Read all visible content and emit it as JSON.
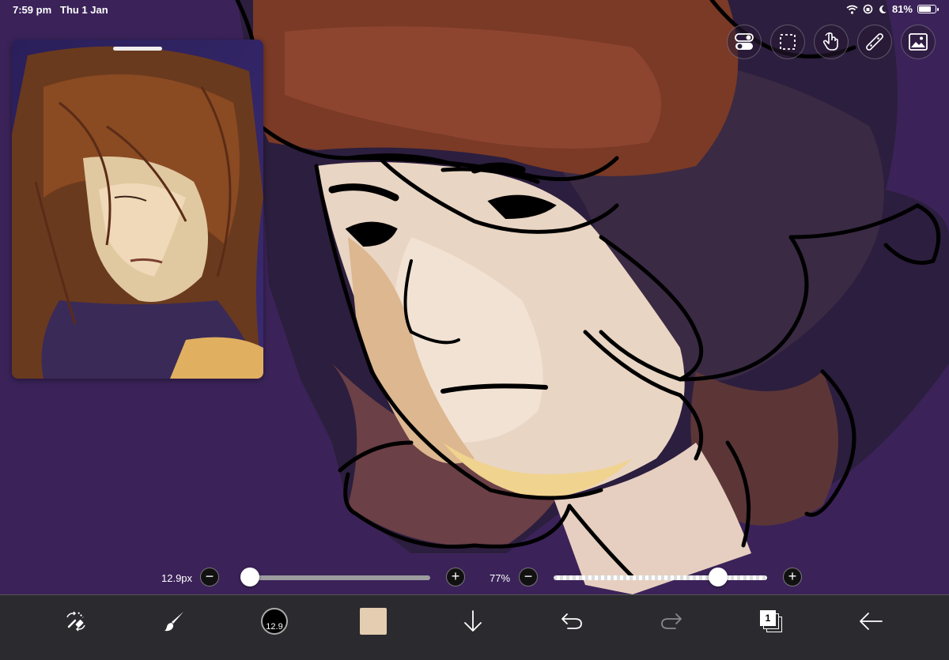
{
  "status": {
    "time": "7:59 pm",
    "date": "Thu 1 Jan",
    "battery": "81%",
    "battery_level": 0.81
  },
  "top_tools": [
    {
      "icon": "toggle-settings-icon"
    },
    {
      "icon": "selection-icon"
    },
    {
      "icon": "gesture-touch-icon"
    },
    {
      "icon": "ruler-icon"
    },
    {
      "icon": "image-import-icon"
    }
  ],
  "sliders": {
    "brush_size_label": "12.9px",
    "brush_size_value": 0.05,
    "opacity_label": "77%",
    "opacity_value": 0.77
  },
  "bottom_tools": {
    "brush_size_badge": "12.9",
    "current_color": "#e4cdb0",
    "layer_count": "1"
  },
  "colors": {
    "canvas_background": "#3b2359",
    "toolbar": "#2b2a2e"
  }
}
